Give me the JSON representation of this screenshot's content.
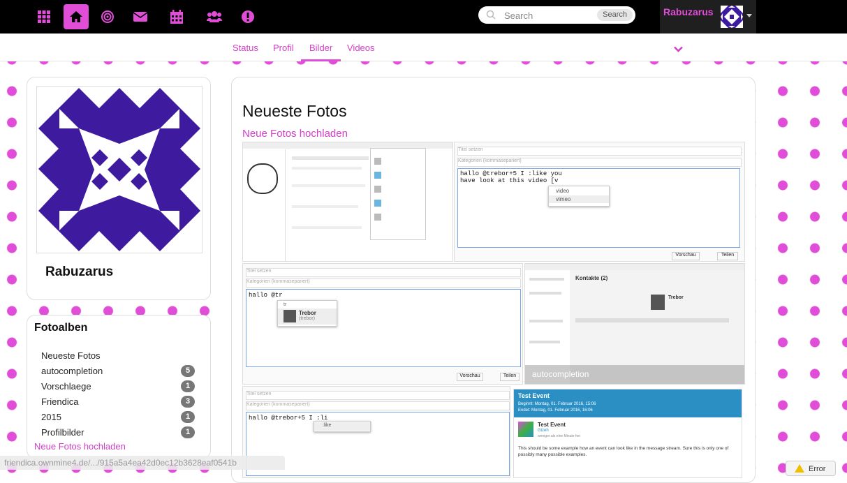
{
  "topbar": {
    "nav_icons": [
      "apps-grid-icon",
      "home-icon",
      "target-icon",
      "envelope-icon",
      "calendar-icon",
      "users-icon",
      "alert-icon"
    ],
    "search": {
      "placeholder": "Search",
      "button": "Search"
    },
    "user": {
      "name": "Rabuzarus"
    }
  },
  "tabs": [
    "Status",
    "Profil",
    "Bilder",
    "Videos"
  ],
  "active_tab": "Bilder",
  "profile": {
    "name": "Rabuzarus"
  },
  "albums": {
    "title": "Fotoalben",
    "items": [
      {
        "label": "Neueste Fotos",
        "count": ""
      },
      {
        "label": "autocompletion",
        "count": "5"
      },
      {
        "label": "Vorschlaege",
        "count": "1"
      },
      {
        "label": "Friendica",
        "count": "3"
      },
      {
        "label": "2015",
        "count": "1"
      },
      {
        "label": "Profilbilder",
        "count": "1"
      }
    ],
    "upload_link": "Neue Fotos hochladen"
  },
  "main": {
    "title": "Neueste Fotos",
    "upload_link": "Neue Fotos hochladen",
    "photos": {
      "p2": {
        "title_placeholder": "Titel setzen",
        "cat_placeholder": "Kategorien (kommasepariert)",
        "line1": "hallo @trebor+5 I :like you",
        "line2": "have look at this video [v",
        "opt1": "video",
        "opt2": "vimeo",
        "btn_preview": "Vorschau",
        "btn_share": "Teilen"
      },
      "p3": {
        "title_placeholder": "Titel setzen",
        "cat_placeholder": "Kategorien (kommasepariert)",
        "line1": "hallo @tr",
        "hint": "tr",
        "name": "Trebor",
        "handle": "(trebor)",
        "btn_preview": "Vorschau",
        "btn_share": "Teilen"
      },
      "p4": {
        "caption": "autocompletion",
        "heading": "Kontakte (2)",
        "contact": "Trebor"
      },
      "p5": {
        "title_placeholder": "Titel setzen",
        "cat_placeholder": "Kategorien (kommasepariert)",
        "line1": "hallo @trebor+5 I :li",
        "opt": ":like"
      },
      "p6": {
        "header": "Test Event",
        "begin": "Beginnt: Montag, 01. Februar 2016, 15:06",
        "end": "Endet: Montag, 01. Februar 2016, 16:06",
        "event_title": "Test Event",
        "event_user": "Gizeh",
        "event_time": "weniger als eine Minute her",
        "body": "This should be some example how an event can look like in the message stream. Sure this is only one of possibly many possible examples."
      }
    }
  },
  "statusbar": {
    "url": "friendica.ownmine4.de/.../915a5a4ea42d0ec12b3628eaf0541b"
  },
  "error": {
    "label": "Error"
  },
  "colors": {
    "accent": "#e04ed8",
    "topbar": "#000000",
    "event_header": "#2b8fc4"
  }
}
